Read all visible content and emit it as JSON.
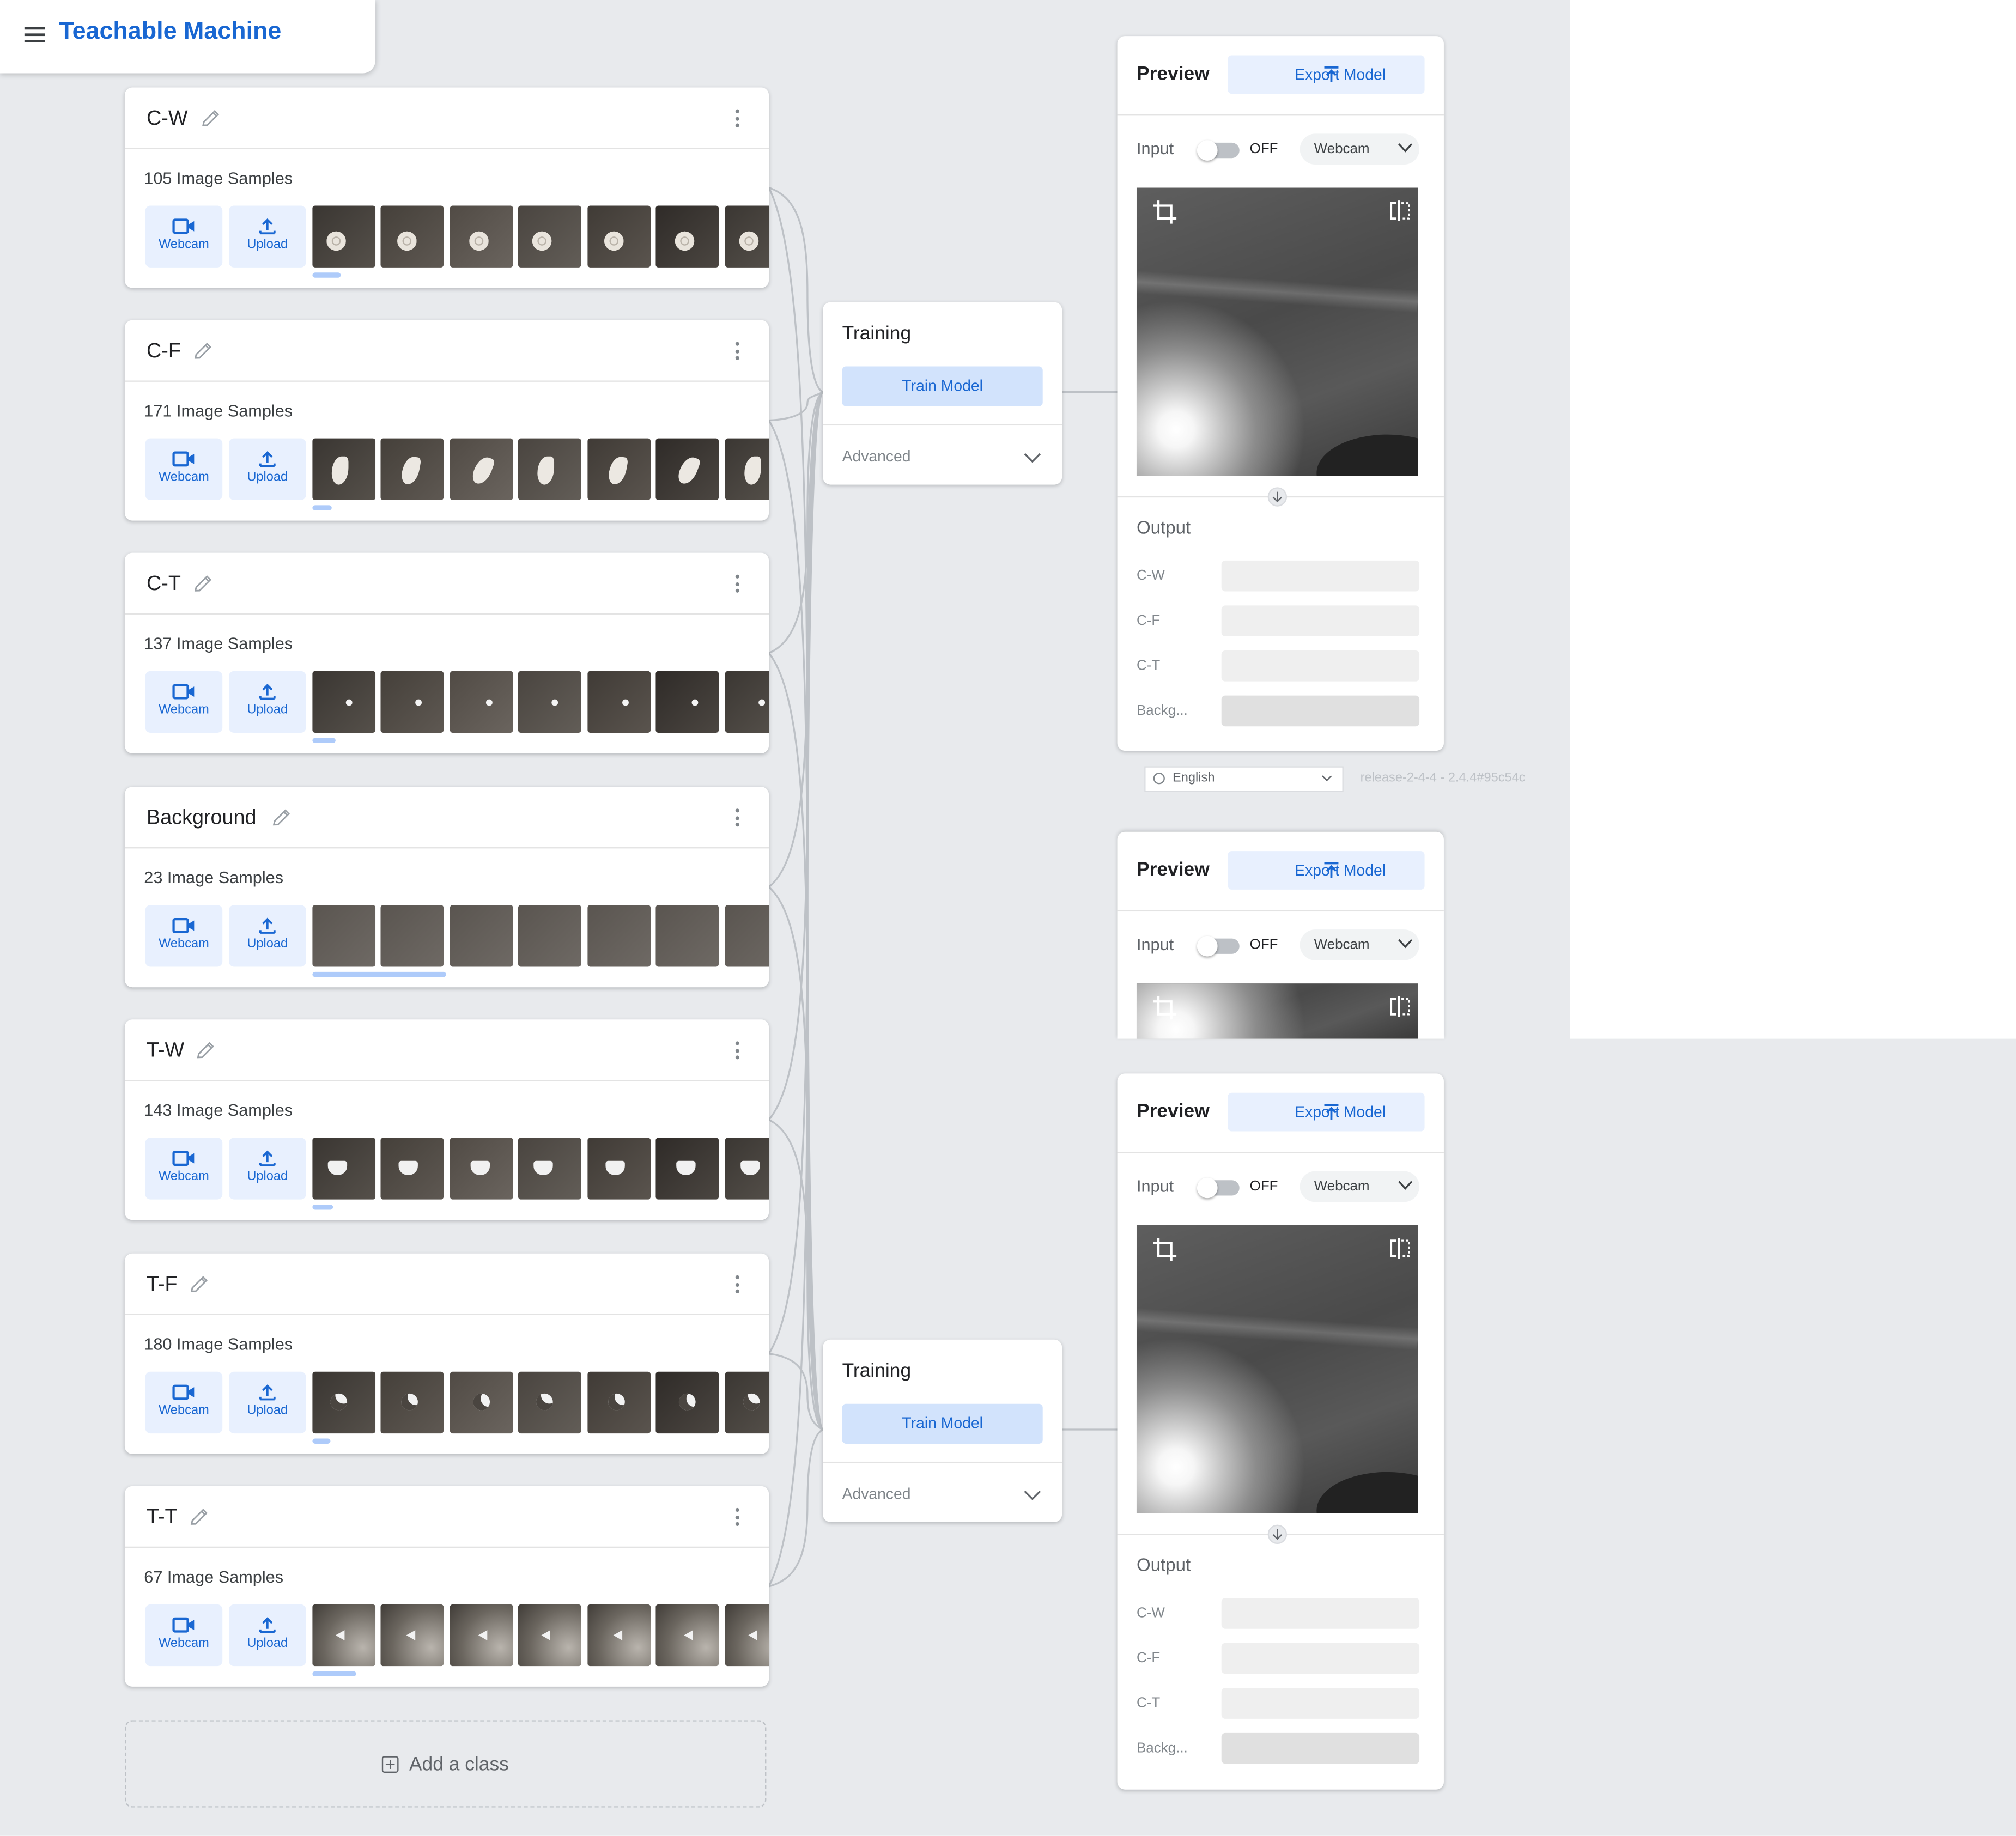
{
  "app": {
    "title": "Teachable Machine"
  },
  "classes": [
    {
      "name": "C-W",
      "count_label": "105 Image Samples",
      "object": "disc"
    },
    {
      "name": "C-F",
      "count_label": "171 Image Samples",
      "object": "claw"
    },
    {
      "name": "C-T",
      "count_label": "137 Image Samples",
      "object": "dot"
    },
    {
      "name": "Background",
      "count_label": "23 Image Samples",
      "object": "none"
    },
    {
      "name": "T-W",
      "count_label": "143 Image Samples",
      "object": "cup"
    },
    {
      "name": "T-F",
      "count_label": "180 Image Samples",
      "object": "crescent"
    },
    {
      "name": "T-T",
      "count_label": "67 Image Samples",
      "object": "triangle"
    }
  ],
  "sample_buttons": {
    "webcam": "Webcam",
    "upload": "Upload"
  },
  "add_class": {
    "label": "Add a class"
  },
  "training": {
    "title": "Training",
    "train_button": "Train Model",
    "advanced": "Advanced"
  },
  "preview": {
    "title": "Preview",
    "export_button": "Export Model",
    "input_label": "Input",
    "toggle_state": "OFF",
    "source": "Webcam",
    "output_label": "Output",
    "outputs": [
      {
        "label": "C-W",
        "confidence": 0
      },
      {
        "label": "C-F",
        "confidence": 0
      },
      {
        "label": "C-T",
        "confidence": 0
      },
      {
        "label": "Backg...",
        "confidence": 0
      }
    ]
  },
  "footer": {
    "language": "English",
    "version": "release-2-4-4 - 2.4.4#95c54c"
  },
  "colors": {
    "accent": "#1967d2",
    "accent_light": "#e8f0fe",
    "background": "#e8eaed"
  },
  "icons": [
    "menu-icon",
    "pencil-icon",
    "more-vert-icon",
    "webcam-icon",
    "upload-icon",
    "export-icon",
    "chevron-down-icon",
    "crop-icon",
    "flip-icon",
    "arrow-down-icon",
    "globe-icon",
    "add-box-icon"
  ]
}
